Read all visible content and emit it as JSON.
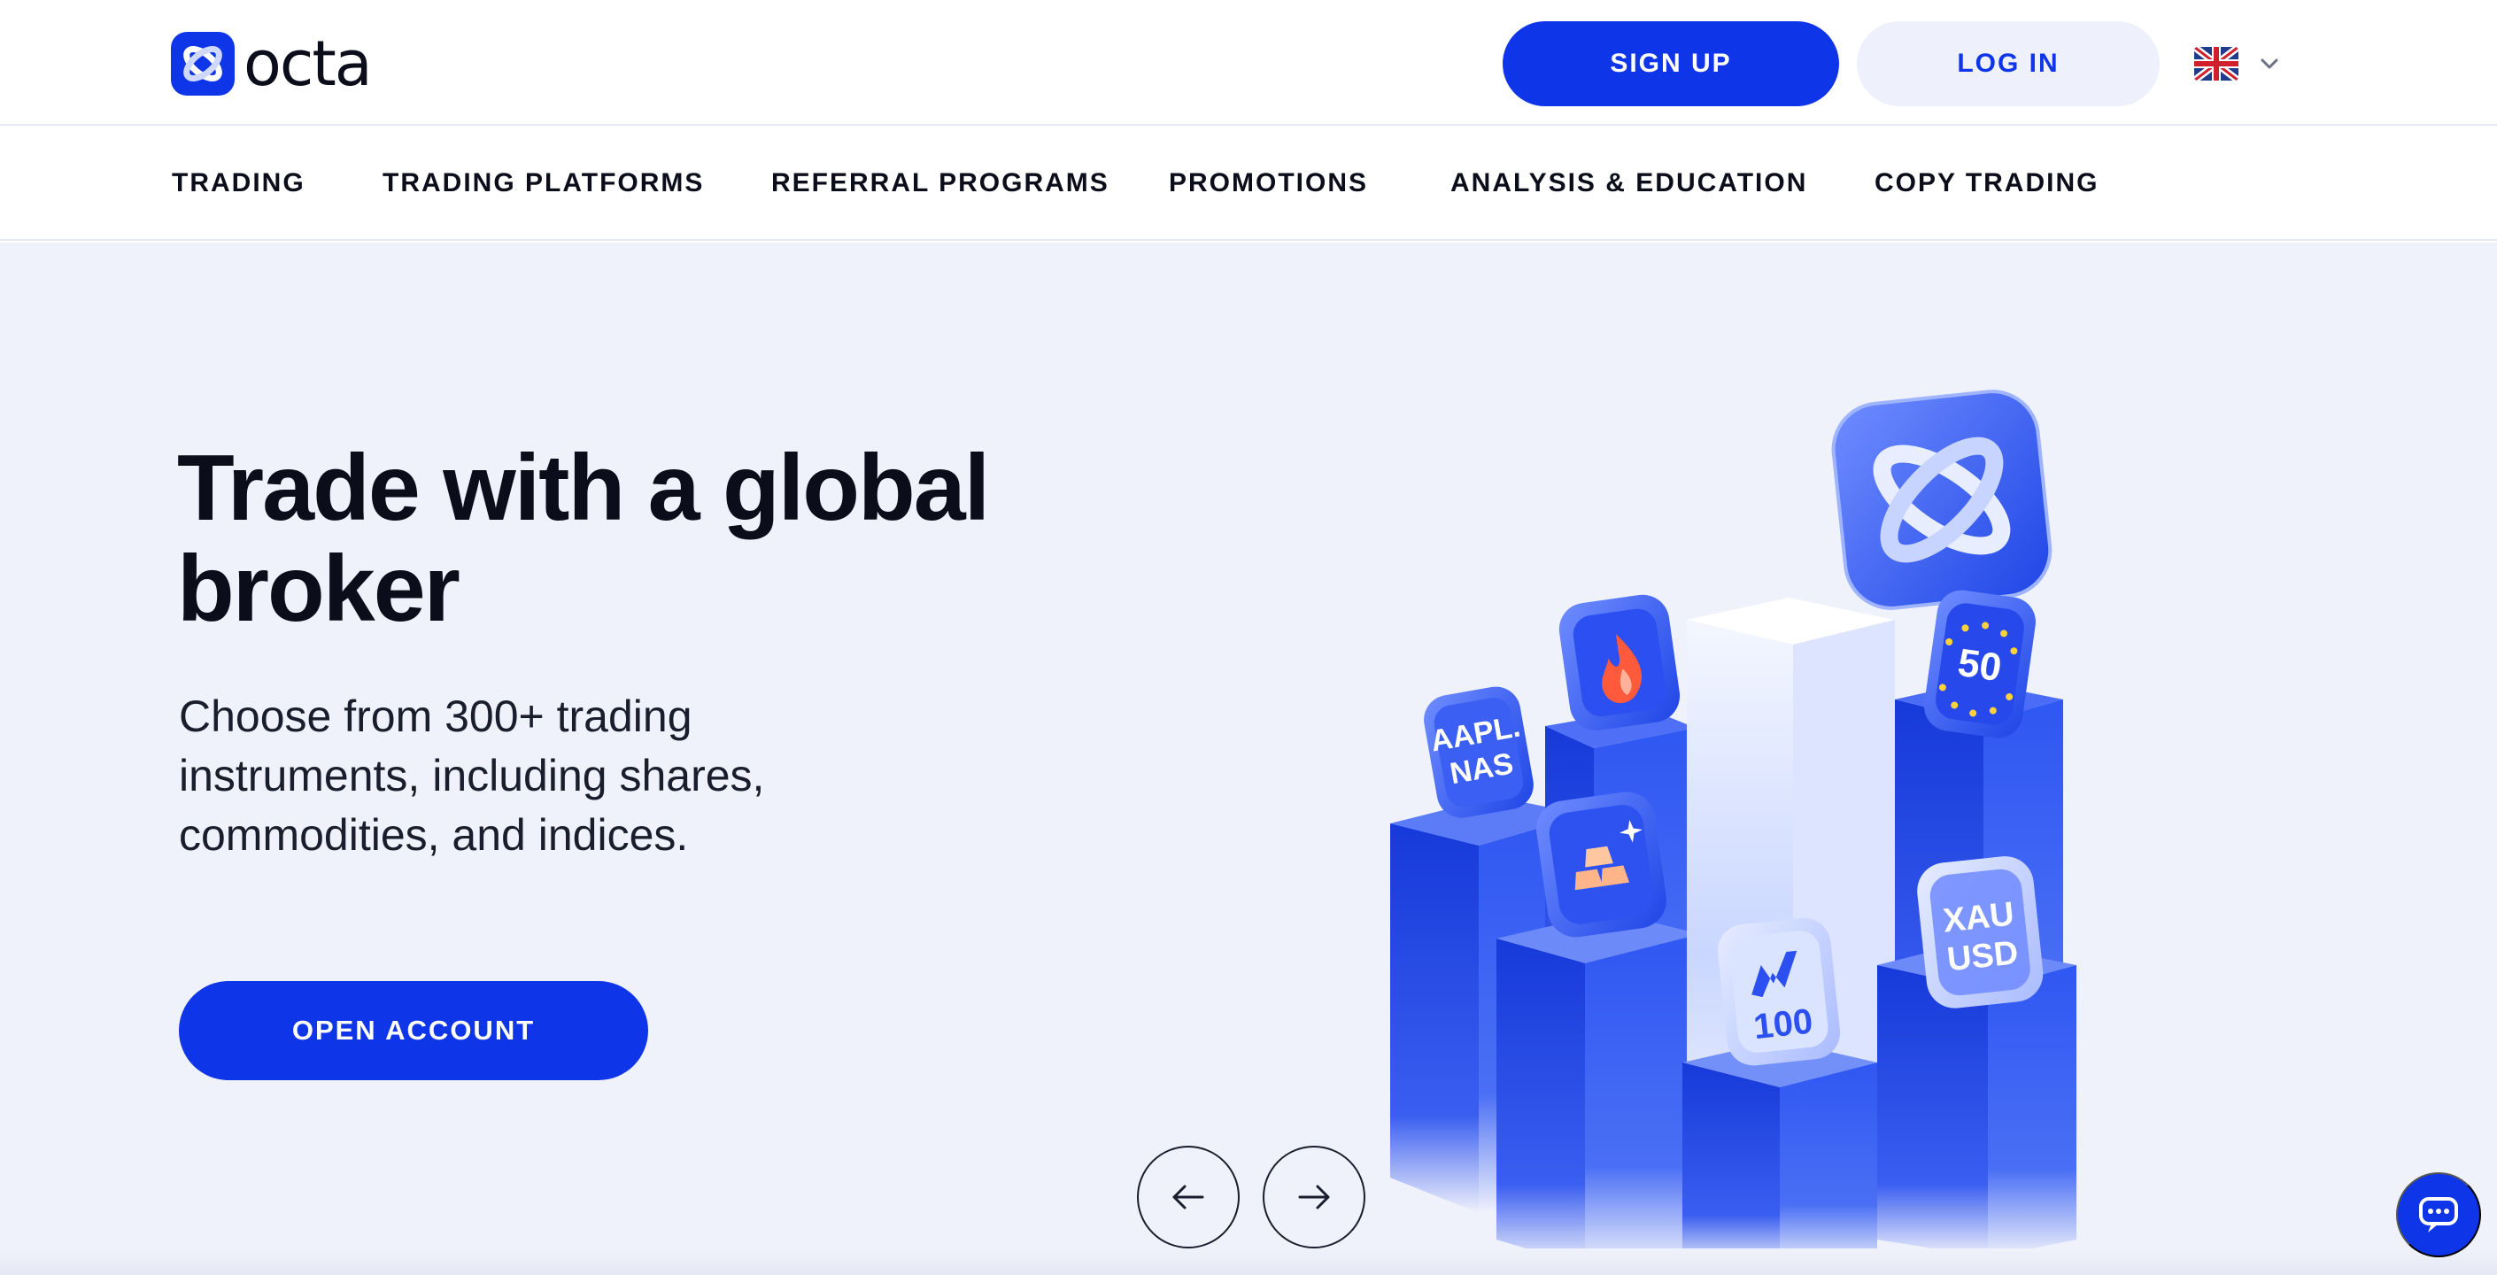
{
  "brand": {
    "name": "octa",
    "logo_icon": "octa-x-icon",
    "accent": "#0f35e8"
  },
  "header": {
    "signup_label": "SIGN UP",
    "login_label": "LOG IN",
    "language_icon": "uk-flag-icon"
  },
  "nav": {
    "items": [
      {
        "label": "TRADING"
      },
      {
        "label": "TRADING PLATFORMS"
      },
      {
        "label": "REFERRAL PROGRAMS"
      },
      {
        "label": "PROMOTIONS"
      },
      {
        "label": "ANALYSIS & EDUCATION"
      },
      {
        "label": "COPY TRADING"
      }
    ]
  },
  "hero": {
    "title": "Trade with a global broker",
    "subtitle": "Choose from 300+ trading instruments, including shares, commodities, and indices.",
    "cta_label": "OPEN ACCOUNT",
    "tiles": {
      "stock": "AAPL. NAS",
      "eu": "50",
      "gold": "XAU USD",
      "nasdaq": "100"
    }
  },
  "carousel": {
    "prev_icon": "arrow-left-icon",
    "next_icon": "arrow-right-icon"
  },
  "chat": {
    "icon": "chat-icon"
  }
}
